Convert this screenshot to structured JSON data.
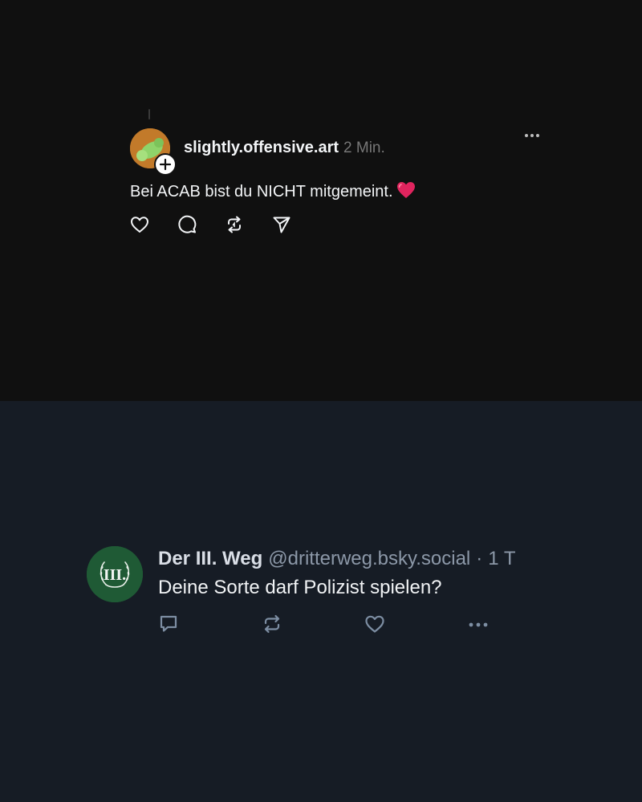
{
  "threads_post": {
    "username": "slightly.offensive.art",
    "time": "2 Min.",
    "text": "Bei ACAB bist du NICHT mitgemeint.",
    "text_emoji": "heart-emoji",
    "icons": [
      "like-icon",
      "reply-icon",
      "repost-icon",
      "share-icon",
      "more-icon"
    ],
    "colors": {
      "background": "#101010",
      "text": "#f3f5f7",
      "muted": "#777777",
      "avatar": "#c27a2a"
    }
  },
  "bluesky_post": {
    "display_name": "Der III. Weg",
    "handle": "@dritterweg.bsky.social",
    "separator": "·",
    "time": "1 T",
    "text": "Deine Sorte darf Polizist spielen?",
    "avatar_monogram": "III.",
    "icons": [
      "reply-icon",
      "repost-icon",
      "like-icon",
      "more-icon"
    ],
    "colors": {
      "background": "#161c25",
      "text": "#f1f3f5",
      "muted": "#8c98a8",
      "avatar": "#1f5a35",
      "icon": "#7d8ea3"
    }
  }
}
